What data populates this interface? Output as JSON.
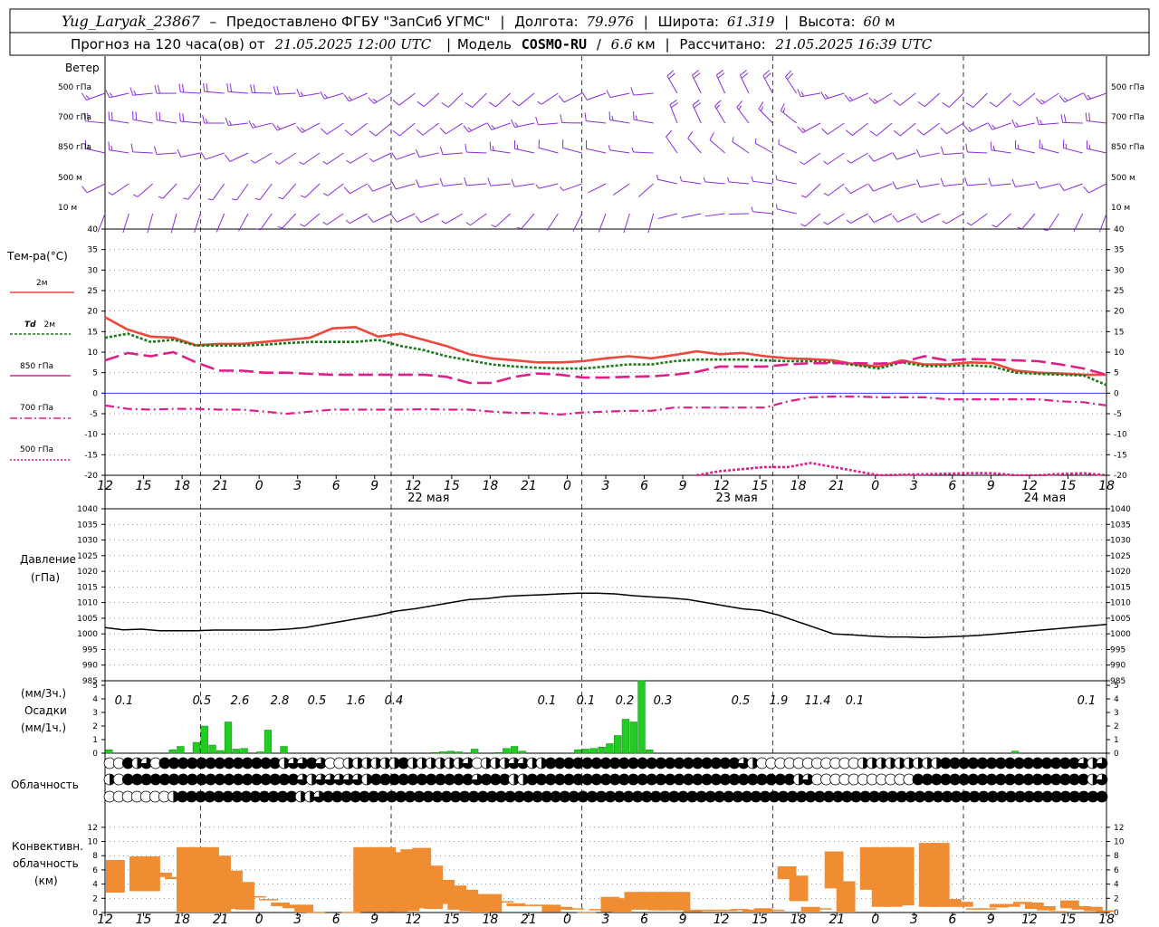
{
  "header": {
    "station": "Yug_Laryak_23867",
    "provider": "Предоставлено ФГБУ \"ЗапСиб УГМС\"",
    "lon_label": "Долгота:",
    "lon_value": "79.976",
    "lat_label": "Широта:",
    "lat_value": "61.319",
    "alt_label": "Высота:",
    "alt_value": "60",
    "alt_unit": "м",
    "forecast_prefix": "Прогноз на 120 часа(ов) от",
    "forecast_time": "21.05.2025 12:00 UTC",
    "model_label": "Модель",
    "model_name": "COSMO-RU",
    "model_res": "6.6",
    "model_res_unit": "км",
    "calc_label": "Рассчитано:",
    "calc_time": "21.05.2025 16:39 UTC"
  },
  "labels": {
    "wind": "Ветер",
    "wind_levels": [
      "500 гПа",
      "700 гПа",
      "850 гПа",
      "500 м",
      "10 м"
    ],
    "temp_title": "Тем-ра(°C)",
    "legend_2m": "2м",
    "legend_td": "Td",
    "legend_td_unit": "2м",
    "legend_850": "850 гПа",
    "legend_700": "700 гПа",
    "legend_500": "500 гПа",
    "pressure_1": "Давление",
    "pressure_2": "(гПа)",
    "precip_1": "(мм/3ч.)",
    "precip_2": "Осадки",
    "precip_3": "(мм/1ч.)",
    "cloud": "Облачность",
    "conv_1": "Конвективн.",
    "conv_2": "облачность",
    "conv_3": "(км)"
  },
  "colors": {
    "wind": "#8a2be2",
    "t2m": "#f0463c",
    "td2m": "#1a7a1a",
    "t850": "#e0208a",
    "t700": "#e0208a",
    "t500": "#e0208a",
    "pressure": "#000000",
    "precip": "#22cc22",
    "convective": "#f08c32"
  },
  "chart_data": [
    {
      "type": "line",
      "title": "Тем-ра(°C)",
      "x_hours_labels": [
        "12",
        "15",
        "18",
        "21",
        "0",
        "3",
        "6",
        "9",
        "12",
        "15",
        "18",
        "21",
        "0",
        "3",
        "6",
        "9",
        "12",
        "15",
        "18",
        "21",
        "0",
        "3",
        "6",
        "9",
        "12",
        "15",
        "18"
      ],
      "dates": [
        "22 мая",
        "23 мая",
        "24 мая"
      ],
      "ylim": [
        -20,
        40
      ],
      "yticks": [
        -20,
        -15,
        -10,
        -5,
        0,
        5,
        10,
        15,
        20,
        25,
        30,
        35,
        40
      ],
      "series": [
        {
          "name": "2м",
          "values": [
            18.5,
            15.5,
            13.8,
            13.5,
            11.7,
            12,
            12,
            12.5,
            13,
            13.5,
            15.8,
            16.1,
            13.8,
            14.5,
            13,
            11.5,
            9.5,
            8.5,
            8,
            7.5,
            7.5,
            7.8,
            8.5,
            9,
            8.5,
            9.3,
            10.2,
            9.5,
            9.8,
            9,
            8.5,
            8.3,
            8,
            7,
            6.5,
            8,
            7,
            7,
            7.5,
            7.3,
            5.5,
            5,
            4.8,
            4.5,
            4.5
          ]
        },
        {
          "name": "Td 2м",
          "values": [
            13.5,
            14.5,
            12.5,
            13,
            11.6,
            11.6,
            11.6,
            11.8,
            12.2,
            12.5,
            12.5,
            12.5,
            13,
            11.5,
            10.5,
            9,
            8,
            7,
            6.5,
            6.2,
            6,
            6,
            6.5,
            7,
            7,
            7.8,
            8.2,
            8.2,
            8.2,
            8,
            7.8,
            7.8,
            7.5,
            6.8,
            6,
            7.5,
            6.6,
            6.6,
            6.8,
            6.5,
            5,
            4.7,
            4.5,
            4.3,
            2
          ]
        },
        {
          "name": "850 гПа",
          "values": [
            8,
            9.8,
            9,
            10,
            7.5,
            5.5,
            5.5,
            5,
            5,
            4.7,
            4.5,
            4.5,
            4.5,
            4.5,
            4.5,
            4,
            2.5,
            2.5,
            4,
            4.8,
            4.5,
            3.8,
            3.8,
            4,
            4.1,
            4.5,
            5.2,
            6.5,
            6.5,
            6.5,
            7,
            7.3,
            7.3,
            7.3,
            7.2,
            7.5,
            9,
            8,
            8.3,
            8.2,
            8,
            7.8,
            7,
            6,
            4.5
          ]
        },
        {
          "name": "700 гПа",
          "values": [
            -3,
            -3.8,
            -4,
            -3.8,
            -3.8,
            -4,
            -4,
            -4.5,
            -5,
            -4.5,
            -4,
            -4,
            -4,
            -4,
            -3.9,
            -4,
            -4,
            -4.5,
            -4.8,
            -4.8,
            -5.2,
            -4.7,
            -4.5,
            -4.3,
            -4.3,
            -3.5,
            -3.5,
            -3.5,
            -3.5,
            -3.5,
            -2,
            -1,
            -0.8,
            -0.8,
            -1,
            -1,
            -1,
            -1.5,
            -1.5,
            -1.5,
            -1.5,
            -1.5,
            -2,
            -2.2,
            -3
          ]
        },
        {
          "name": "500 гПа",
          "values": [
            -22,
            -22,
            -22,
            -22,
            -22,
            -22,
            -22,
            -22,
            -22,
            -22,
            -22,
            -22,
            -22,
            -22,
            -22,
            -22,
            -22,
            -22,
            -22,
            -22,
            -22,
            -22,
            -22,
            -22,
            -22,
            -22,
            -20,
            -19,
            -18.5,
            -18,
            -18,
            -17,
            -18,
            -19,
            -20,
            -21,
            -21,
            -21,
            -19.5,
            -19.5,
            -20,
            -20,
            -19.7,
            -19.5,
            -20
          ]
        }
      ]
    },
    {
      "type": "line",
      "title": "Давление",
      "ylim": [
        985,
        1040
      ],
      "yticks": [
        985,
        990,
        995,
        1000,
        1005,
        1010,
        1015,
        1020,
        1025,
        1030,
        1035,
        1040
      ],
      "series": [
        {
          "name": "Давление",
          "values": [
            1002,
            1001.3,
            1001.5,
            1001,
            1001,
            1001,
            1001.2,
            1001.2,
            1001.2,
            1001.2,
            1001.5,
            1002,
            1003,
            1004,
            1005,
            1006,
            1007.3,
            1008,
            1009,
            1010,
            1011,
            1011.3,
            1012,
            1012.3,
            1012.5,
            1012.8,
            1013,
            1013,
            1012.8,
            1012.2,
            1011.8,
            1011.5,
            1011,
            1010,
            1009,
            1008,
            1007.5,
            1006,
            1004,
            1002,
            1000,
            999.7,
            999.3,
            999,
            999,
            998.8,
            999,
            999.2,
            999.5,
            1000,
            1000.5,
            1001,
            1001.5,
            1002,
            1002.5,
            1003
          ]
        }
      ]
    },
    {
      "type": "bar",
      "title": "Осадки",
      "ylim": [
        0,
        5
      ],
      "yticks": [
        0,
        1,
        2,
        3,
        4,
        5
      ],
      "series": [
        {
          "name": "мм/1ч.",
          "values": [
            0.25,
            0,
            0,
            0,
            0,
            0,
            0,
            0,
            0.25,
            0.5,
            0,
            0.8,
            2,
            0.6,
            0.2,
            2.3,
            0.3,
            0.35,
            0,
            0.1,
            1.7,
            0,
            0.5,
            0,
            0,
            0,
            0,
            0,
            0,
            0,
            0,
            0,
            0,
            0,
            0,
            0,
            0,
            0,
            0,
            0,
            0,
            0.05,
            0.1,
            0.15,
            0.1,
            0,
            0.3,
            0,
            0,
            0.05,
            0.35,
            0.5,
            0.15,
            0,
            0,
            0,
            0,
            0,
            0,
            0.25,
            0.3,
            0.35,
            0.45,
            0.7,
            1.3,
            2.5,
            2.3,
            6,
            0.25,
            0,
            0,
            0,
            0,
            0,
            0,
            0,
            0,
            0,
            0,
            0,
            0,
            0,
            0,
            0,
            0,
            0,
            0,
            0,
            0,
            0,
            0,
            0,
            0,
            0,
            0,
            0,
            0,
            0,
            0,
            0,
            0,
            0,
            0,
            0,
            0,
            0,
            0,
            0,
            0,
            0,
            0,
            0,
            0,
            0,
            0.15,
            0
          ]
        }
      ],
      "labels_3h": [
        {
          "value": "0.1",
          "hour": "12"
        },
        {
          "value": "0.5",
          "hour": "21"
        },
        {
          "value": "2.6",
          "hour": "0"
        },
        {
          "value": "2.8",
          "hour": "3"
        },
        {
          "value": "0.5",
          "hour": "6"
        },
        {
          "value": "1.6",
          "hour": "9"
        },
        {
          "value": "0.4",
          "hour": "12"
        },
        {
          "value": "0.1",
          "hour": "0"
        },
        {
          "value": "0.1",
          "hour": "3"
        },
        {
          "value": "0.2",
          "hour": "6"
        },
        {
          "value": "0.3",
          "hour": "9"
        },
        {
          "value": "0.5",
          "hour": "15"
        },
        {
          "value": "1.9",
          "hour": "18"
        },
        {
          "value": "11.4",
          "hour": "21"
        },
        {
          "value": "0.1",
          "hour": "0"
        },
        {
          "value": "0.1",
          "hour": "18"
        }
      ]
    },
    {
      "type": "table",
      "title": "Облачность",
      "rows_fraction_eighths": [
        [
          0,
          0,
          8,
          4,
          6,
          0,
          8,
          8,
          8,
          8,
          8,
          8,
          8,
          8,
          8,
          8,
          8,
          8,
          8,
          4,
          6,
          6,
          8,
          6,
          0,
          0,
          4,
          4,
          4,
          4,
          4,
          4,
          8,
          4,
          4,
          4,
          4,
          4,
          4,
          6,
          0,
          4,
          4,
          4,
          6,
          6,
          4,
          4,
          8,
          8,
          8,
          8,
          8,
          8,
          8,
          8,
          8,
          8,
          8,
          8,
          8,
          8,
          8,
          8,
          8,
          8,
          8,
          8,
          8,
          6,
          4,
          0,
          0,
          0,
          0,
          0,
          0,
          0,
          0,
          0,
          0,
          0,
          4,
          4,
          4,
          4,
          4,
          4,
          4,
          4,
          4,
          8,
          8,
          8,
          8,
          8,
          8,
          8,
          8,
          8,
          8,
          8,
          8,
          8,
          8,
          8,
          6,
          4,
          6
        ],
        [
          4,
          0,
          8,
          8,
          8,
          8,
          8,
          8,
          8,
          8,
          8,
          8,
          8,
          8,
          8,
          8,
          8,
          8,
          8,
          8,
          8,
          6,
          4,
          6,
          6,
          6,
          6,
          6,
          4,
          8,
          8,
          8,
          8,
          8,
          8,
          8,
          8,
          8,
          8,
          8,
          6,
          8,
          8,
          8,
          4,
          4,
          8,
          8,
          8,
          8,
          8,
          8,
          8,
          8,
          8,
          8,
          8,
          8,
          8,
          8,
          8,
          8,
          8,
          8,
          8,
          8,
          8,
          8,
          8,
          8,
          8,
          8,
          8,
          8,
          8,
          4,
          6,
          0,
          0,
          0,
          0,
          0,
          0,
          0,
          0,
          0,
          0,
          0,
          8,
          8,
          8,
          8,
          8,
          8,
          8,
          8,
          8,
          8,
          8,
          8,
          8,
          8,
          8,
          8,
          8,
          8,
          8,
          4,
          6
        ],
        [
          0,
          0,
          0,
          0,
          0,
          0,
          0,
          4,
          8,
          8,
          8,
          8,
          8,
          8,
          8,
          8,
          8,
          8,
          8,
          8,
          8,
          4,
          4,
          6,
          8,
          8,
          8,
          8,
          8,
          8,
          8,
          8,
          8,
          8,
          8,
          8,
          8,
          8,
          8,
          8,
          8,
          8,
          8,
          8,
          8,
          8,
          8,
          8,
          8,
          8,
          8,
          8,
          8,
          8,
          8,
          8,
          8,
          8,
          8,
          8,
          8,
          8,
          8,
          8,
          8,
          8,
          8,
          8,
          8,
          8,
          8,
          8,
          8,
          8,
          8,
          8,
          8,
          8,
          8,
          8,
          8,
          8,
          8,
          8,
          8,
          8,
          8,
          8,
          8,
          8,
          8,
          8,
          8,
          8,
          8,
          8,
          8,
          8,
          8,
          8,
          8,
          8,
          8,
          8,
          8,
          8,
          8,
          8,
          8,
          8
        ]
      ]
    },
    {
      "type": "bar",
      "title": "Конвективн. облачность",
      "ylim": [
        0,
        13
      ],
      "yticks": [
        0,
        2,
        4,
        6,
        8,
        10,
        12
      ],
      "series": [
        {
          "name": "нижняя граница (км)",
          "values": [
            2.8,
            0,
            3.0,
            3.0,
            5.0,
            4.7,
            0,
            0,
            0,
            0,
            0.5,
            0.4,
            2.3,
            1.9,
            0.9,
            0.6,
            0.0,
            0.1,
            0.0,
            0.0,
            0.1,
            0.1,
            0.1,
            0.1,
            0.1,
            0.2,
            0.6,
            0.5,
            1.2,
            0.4,
            0.2,
            0.0,
            0.1,
            1.6,
            0.9,
            1.1,
            1.1,
            0.1,
            0.4,
            0.6,
            0.1,
            0.5,
            0.1,
            0.0,
            0.4,
            0.4,
            0.3,
            0.3,
            0.3,
            0.1,
            0.4,
            2.3,
            0.6,
            0.5,
            0.0,
            0.0,
            0.4,
            4.7,
            1.6,
            0.0,
            0.6,
            3.4,
            0.0,
            0.0,
            3.2,
            0.8,
            0.8,
            1.0,
            0.8,
            0.8,
            0.8,
            0.8,
            0.8,
            0.5,
            0.5,
            0.7,
            0.8,
            1.2,
            0.5,
            0.3,
            0.2,
            0.6,
            0.4,
            0.2,
            0.3
          ]
        },
        {
          "name": "верхняя граница (км)",
          "values": [
            7.4,
            0,
            7.9,
            7.9,
            5.6,
            5.0,
            9.2,
            9.2,
            9.2,
            8.0,
            5.9,
            4.3,
            2.3,
            1.9,
            1.4,
            1.1,
            1.1,
            0.1,
            0.0,
            0.0,
            0.1,
            9.2,
            9.2,
            9.2,
            8.5,
            8.9,
            9.1,
            6.6,
            4.6,
            3.8,
            3.2,
            2.6,
            2.6,
            1.6,
            1.3,
            1.1,
            1.1,
            1.1,
            0.8,
            0.6,
            0.1,
            0.5,
            2.2,
            2.0,
            2.9,
            2.9,
            2.9,
            2.9,
            2.9,
            0.4,
            0.4,
            0.4,
            0.4,
            0.5,
            0.4,
            0.6,
            0.4,
            6.5,
            5.2,
            0.8,
            0.6,
            8.6,
            4.4,
            0.0,
            9.2,
            9.2,
            9.2,
            9.2,
            0.0,
            9.8,
            9.8,
            1.9,
            1.5,
            0.6,
            0.6,
            1.2,
            1.2,
            1.5,
            1.4,
            0.9,
            0.2,
            1.7,
            0.9,
            0.8,
            0.3
          ]
        }
      ]
    },
    {
      "type": "scatter",
      "title": "Ветер",
      "levels": [
        "500 гПа",
        "700 гПа",
        "850 гПа",
        "500 м",
        "10 м"
      ],
      "description_values": [
        {
          "level": "500 гПа",
          "dir_deg": 250,
          "speed_ms": 15
        },
        {
          "level": "700 гПа",
          "dir_deg": 255,
          "speed_ms": 15
        },
        {
          "level": "850 гПа",
          "dir_deg": 260,
          "speed_ms": 10
        },
        {
          "level": "500 м",
          "dir_deg": 240,
          "speed_ms": 8
        },
        {
          "level": "10 м",
          "dir_deg": 220,
          "speed_ms": 4
        }
      ]
    }
  ]
}
